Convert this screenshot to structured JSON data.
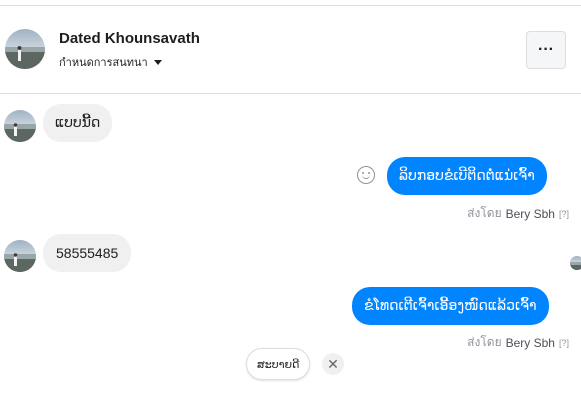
{
  "header": {
    "name": "Dated Khounsavath",
    "subtitle": "กำหนดการสนทนา",
    "more_label": "···"
  },
  "messages": [
    {
      "direction": "in",
      "text": "ແບບນີ້ດ"
    },
    {
      "direction": "out",
      "text": "ລິບກອບຂໍເບີຕິດຕໍ່ແນ່ເຈົ້າ",
      "sent_by_prefix": "ส่งโดย",
      "sent_by_name": "Bery Sbh",
      "help": "[?]"
    },
    {
      "direction": "in",
      "text": "58555485"
    },
    {
      "direction": "out",
      "text": "ຂໍໂທດເຕີເຈົ້າເອີ້ອງໜົດແລ້ວເຈົ້າ",
      "sent_by_prefix": "ส่งโดย",
      "sent_by_name": "Bery Sbh",
      "help": "[?]"
    }
  ],
  "quick_reply": {
    "label": "ສະບາຍດີ",
    "close": "✕"
  },
  "colors": {
    "outgoing_bubble": "#0084ff",
    "incoming_bubble": "#f0f0f0",
    "meta_text": "#90949c"
  }
}
